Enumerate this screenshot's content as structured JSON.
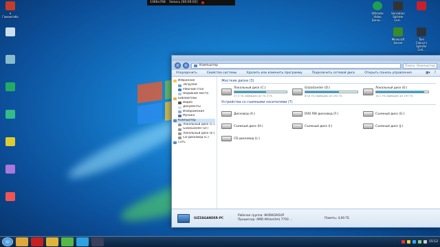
{
  "recording_bar": {
    "left_text": "1366x768",
    "status": "Запись [00:00:02]"
  },
  "desktop": {
    "left_icons": [
      {
        "label": "к Гамаютабе",
        "color": "#c43d2b"
      }
    ],
    "right_icons": [
      {
        "label": "Ultimate Video Servic...",
        "color": "#1f9e55"
      },
      {
        "label": "Sensation Splinter Cell...",
        "color": "#333333"
      },
      {
        "label": "",
        "color": "#c8202a"
      },
      {
        "label": "Minecraft Server",
        "color": "#3b8a2a"
      },
      {
        "label": "Tom Clancy's Splinter Cell...",
        "color": "#2b3340"
      },
      {
        "label": "",
        "color": "#d33"
      }
    ]
  },
  "window": {
    "address_path": "Компьютер",
    "search_placeholder": "Поиск: Компьютер",
    "command_bar": [
      "Упорядочить",
      "Свойства системы",
      "Удалить или изменить программу",
      "Подключить сетевой диск",
      "Открыть панель управления"
    ],
    "nav_pane": [
      {
        "label": "Избранное",
        "level": 0,
        "color": "#f2c94c"
      },
      {
        "label": "Загрузки",
        "level": 1,
        "color": "#6aa3d9"
      },
      {
        "label": "Рабочий стол",
        "level": 1,
        "color": "#4a7fc0"
      },
      {
        "label": "Недавние места",
        "level": 1,
        "color": "#b6c6d6"
      },
      {
        "label": "Библиотеки",
        "level": 0,
        "color": "#e3b44a"
      },
      {
        "label": "Видео",
        "level": 1,
        "color": "#555"
      },
      {
        "label": "Документы",
        "level": 1,
        "color": "#dcdcdc"
      },
      {
        "label": "Изображения",
        "level": 1,
        "color": "#7ab3e0"
      },
      {
        "label": "Музыка",
        "level": 1,
        "color": "#6a6aaa"
      },
      {
        "label": "Компьютер",
        "level": 0,
        "color": "#5a8bc7",
        "selected": true
      },
      {
        "label": "Локальный диск (C:)",
        "level": 1,
        "color": "#999"
      },
      {
        "label": "GizzaGander (D:)",
        "level": 1,
        "color": "#999"
      },
      {
        "label": "Локальный диск (E:)",
        "level": 1,
        "color": "#999"
      },
      {
        "label": "CD-дисковод (L:)",
        "level": 1,
        "color": "#999"
      },
      {
        "label": "Сеть",
        "level": 0,
        "color": "#5a8bc7"
      }
    ],
    "hard_disks_header": "Жесткие диски (3)",
    "hard_disks": [
      {
        "name": "Локальный диск (C:)",
        "free": "27,3 ГБ свободно из 70,3 ГБ",
        "used_fraction": 0.61
      },
      {
        "name": "GizzaGander (D:)",
        "free": "83,8 ГБ свободно из 232 ГБ",
        "used_fraction": 0.64
      },
      {
        "name": "Локальный диск (E:)",
        "free": "16,1 ГБ свободно из 197 ГБ",
        "used_fraction": 0.92
      }
    ],
    "removable_header": "Устройства со съемными носителями (7)",
    "removable": [
      "Дисковод (A:)",
      "DVD RW дисковод (F:)",
      "Съемный диск (G:)",
      "Съемный диск (H:)",
      "Съемный диск (I:)",
      "Съемный диск (J:)",
      "CD-дисковод (L:)"
    ],
    "details": {
      "pc_name": "GIZZAGANDER-PC",
      "workgroup_label": "Рабочая группа:",
      "workgroup": "WORKGROUP",
      "memory_label": "Память:",
      "memory": "4,00 ГБ",
      "cpu_label": "Процессор:",
      "cpu": "AMD Athlon(tm) 7750 ..."
    }
  },
  "taskbar": {
    "apps": [
      {
        "name": "explorer",
        "color": "#e0a83a"
      },
      {
        "name": "opera",
        "color": "#c62020"
      },
      {
        "name": "chrome",
        "color": "#dfb43a"
      },
      {
        "name": "utorrent",
        "color": "#58b847"
      },
      {
        "name": "skype",
        "color": "#2aa3e0"
      },
      {
        "name": "media",
        "color": "#3a3f5c"
      }
    ],
    "clock": "15:12"
  }
}
